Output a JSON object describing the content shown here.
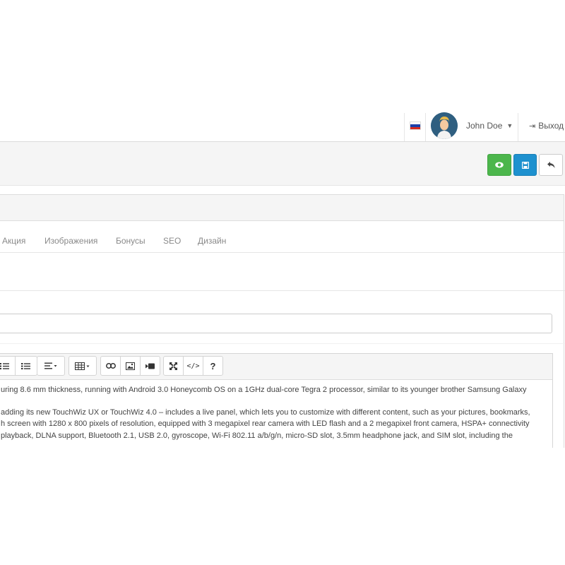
{
  "header": {
    "language_flag": "ru-flag",
    "user_name": "John Doe",
    "logout_label": "Выход"
  },
  "toolbar_actions": {
    "preview": "eye-icon",
    "save": "save-icon",
    "back": "reply-icon"
  },
  "colors": {
    "preview_button": "#4cb64c",
    "save_button": "#1e91cf",
    "header_bg": "#f5f5f5"
  },
  "tabs": [
    {
      "label": "Акция"
    },
    {
      "label": "Изображения"
    },
    {
      "label": "Бонусы"
    },
    {
      "label": "SEO"
    },
    {
      "label": "Дизайн"
    }
  ],
  "editor": {
    "toolbar_icons": [
      "unordered-list-icon",
      "ordered-list-icon",
      "align-icon",
      "table-icon",
      "link-icon",
      "image-icon",
      "video-icon",
      "fullscreen-icon",
      "code-view-icon",
      "help-icon"
    ],
    "code_view_label": "</>",
    "help_label": "?",
    "lines": [
      "uring 8.6 mm thickness, running with Android 3.0 Honeycomb OS on a 1GHz dual-core Tegra 2 processor, similar to its younger brother Samsung Galaxy",
      "",
      "adding its new TouchWiz UX or TouchWiz 4.0 – includes a live panel, which lets you to customize with different content, such as your pictures, bookmarks,",
      "h screen with 1280 x 800 pixels of resolution, equipped with 3 megapixel rear camera with LED flash and a 2 megapixel front camera, HSPA+ connectivity",
      " playback, DLNA support, Bluetooth 2.1, USB 2.0, gyroscope, Wi-Fi 802.11 a/b/g/n, micro-SD slot, 3.5mm headphone jack, and SIM slot, including the"
    ]
  }
}
